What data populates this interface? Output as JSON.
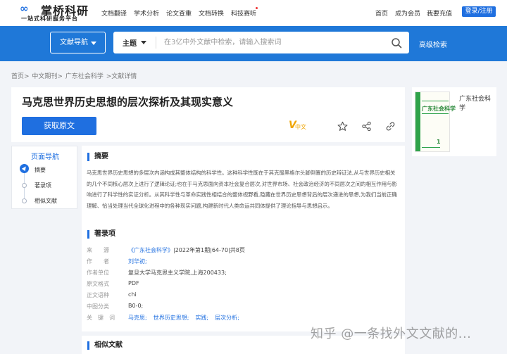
{
  "header": {
    "logo_name": "掌桥科研",
    "logo_slogan": "一站式科研服务平台",
    "nav": [
      "文档翻译",
      "学术分析",
      "论文查重",
      "文档转换",
      "科技赛听"
    ],
    "right_links": [
      "首页",
      "成为会员",
      "我要充值"
    ],
    "login_label": "登录/注册"
  },
  "search": {
    "nav_label": "文献导航",
    "type_label": "主题",
    "placeholder": "在3亿中外文献中检索，请输入搜索词",
    "advanced_label": "高级检索"
  },
  "breadcrumb": [
    "首页>",
    "中文期刊>",
    "广东社会科学",
    ">文献详情"
  ],
  "article": {
    "title": "马克思世界历史思想的层次探析及其现实意义",
    "get_button": "获取原文",
    "badge_letter": "V",
    "badge_text": "中文"
  },
  "cover": {
    "journal_name": "广东社会科学",
    "cover_title": "广东社会科学",
    "cover_issue": "1"
  },
  "side_nav": {
    "title": "页面导航",
    "items": [
      "摘要",
      "著录项",
      "相似文献"
    ]
  },
  "abstract": {
    "heading": "摘要",
    "text": "马克思世界历史思想的多层次内涵构成其整体结构的科学性。这种科学性既在于其克服黑格尔头脚倒置的历史辩证法,从与世界历史相关的几个不同核心层次上进行了逻辑论证;也在于马克思面向资本社会复合层次,对世界市场、社会政治经济的不同层次之间的相互作用与影响进行了科学性的实证分析。从其科学性与革命实践性相结合的整体视野看,隐藏在世界历史思想背后的层次递进的思想,为我们当前正确理解、恰当处理当代全球化进程中的各种现实问题,构建新时代人类命运共同体提供了理论指导与思想启示。"
  },
  "record": {
    "heading": "著录项",
    "rows": [
      {
        "label": "来　　源",
        "value": "《广东社会科学》",
        "extra": "|2022年第1期|64-70|共8页"
      },
      {
        "label": "作　　者",
        "value": "刘华初;"
      },
      {
        "label": "作者单位",
        "value": "复旦大学马克思主义学院,上海200433;"
      },
      {
        "label": "原文格式",
        "value": "PDF"
      },
      {
        "label": "正文语种",
        "value": "chi"
      },
      {
        "label": "中图分类",
        "value": "B0-0;"
      },
      {
        "label": "关　键　词",
        "keywords": [
          "马克思;",
          "世界历史思想;",
          "实践;",
          "层次分析;"
        ]
      }
    ]
  },
  "similar": {
    "heading": "相似文献"
  },
  "watermark": "知乎 @一条找外文文献的...",
  "colors": {
    "primary": "#1f6fe0",
    "banner": "#1f78d8",
    "badge": "#f0a500"
  }
}
